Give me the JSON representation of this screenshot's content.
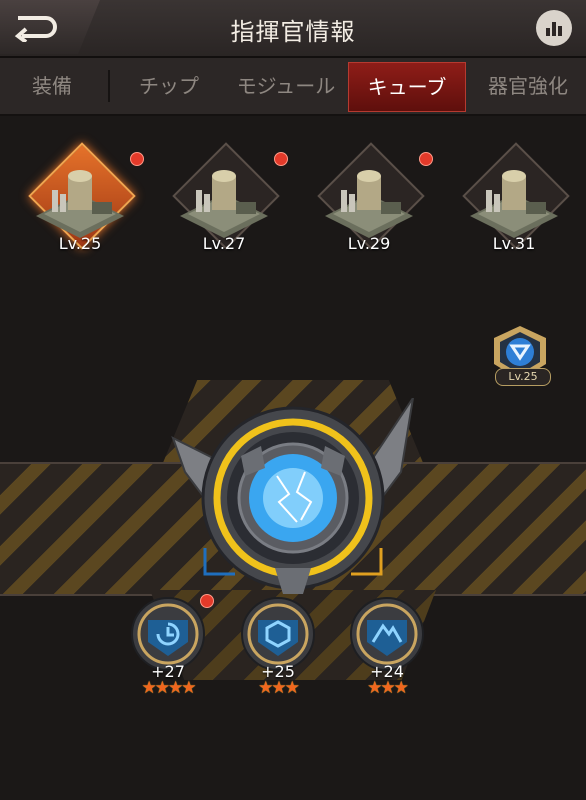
{
  "header": {
    "title": "指揮官情報",
    "back_icon": "back-arrow-icon",
    "stats_icon": "bar-chart-icon"
  },
  "tabs": [
    {
      "label": "装備",
      "active": false
    },
    {
      "label": "チップ",
      "active": false
    },
    {
      "label": "モジュール",
      "active": false
    },
    {
      "label": "キューブ",
      "active": true
    },
    {
      "label": "器官強化",
      "active": false
    }
  ],
  "buildings": [
    {
      "level": "Lv.25",
      "selected": true,
      "notify": true
    },
    {
      "level": "Lv.27",
      "selected": false,
      "notify": true
    },
    {
      "level": "Lv.29",
      "selected": false,
      "notify": true
    },
    {
      "level": "Lv.31",
      "selected": false,
      "notify": true
    }
  ],
  "cube_badge": {
    "level": "Lv.25"
  },
  "skills": [
    {
      "value": "+27",
      "stars": "★★★★",
      "icon": "cooldown-icon",
      "notify": true
    },
    {
      "value": "+25",
      "stars": "★★★",
      "icon": "hexagon-icon",
      "notify": false
    },
    {
      "value": "+24",
      "stars": "★★★",
      "icon": "mountain-icon",
      "notify": false
    }
  ],
  "colors": {
    "accent_red": "#8e1d18",
    "glow_orange": "#e5722a",
    "core_blue": "#3aa6f0",
    "ring_yellow": "#f0c21b"
  }
}
